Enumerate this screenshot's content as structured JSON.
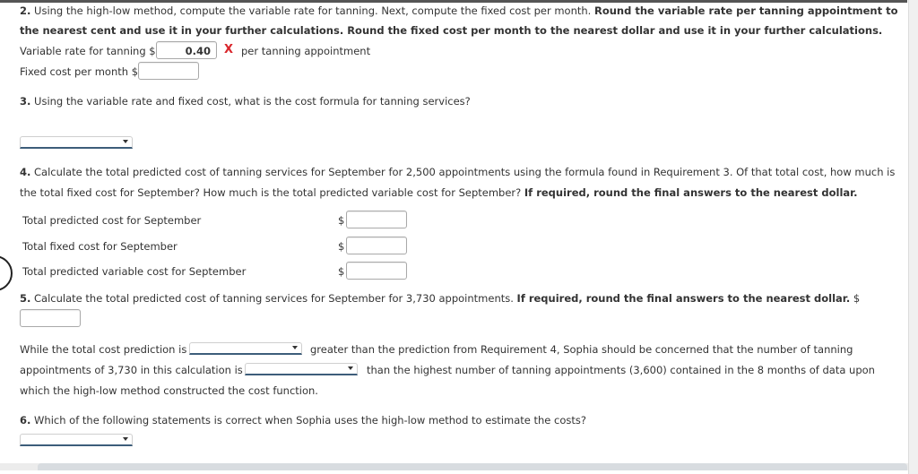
{
  "q2": {
    "number": "2.",
    "text_line1_normal": "Using the high-low method, compute the variable rate for tanning. Next, compute the fixed cost per month.",
    "text_line1_bold": "Round the variable rate per tanning appointment to",
    "text_line2_bold": "the nearest cent and use it in your further calculations. Round the fixed cost per month to the nearest dollar and use it in your further calculations.",
    "variable_rate_label": "Variable rate for tanning $",
    "variable_rate_value": "0.40",
    "variable_rate_status_icon": "x-mark-incorrect",
    "variable_rate_status_glyph": "X",
    "variable_rate_unit": "per tanning appointment",
    "fixed_cost_label": "Fixed cost per month $",
    "fixed_cost_value": ""
  },
  "q3": {
    "number": "3.",
    "text": "Using the variable rate and fixed cost, what is the cost formula for tanning services?",
    "select_value": ""
  },
  "q4": {
    "number": "4.",
    "text_line1": "Calculate the total predicted cost of tanning services for September for 2,500 appointments using the formula found in Requirement 3. Of that total cost, how much is",
    "text_line2_normal": "the total fixed cost for September? How much is the total predicted variable cost for September?",
    "text_line2_bold": "If required, round the final answers to the nearest dollar.",
    "rows": [
      {
        "label": "Total predicted cost for September",
        "currency": "$",
        "value": ""
      },
      {
        "label": "Total fixed cost for September",
        "currency": "$",
        "value": ""
      },
      {
        "label": "Total predicted variable cost for September",
        "currency": "$",
        "value": ""
      }
    ]
  },
  "q5": {
    "number": "5.",
    "text_normal": "Calculate the total predicted cost of tanning services for September for 3,730 appointments.",
    "text_bold": "If required, round the final answers to the nearest dollar.",
    "currency": "$",
    "answer_value": "",
    "para_part1": "While the total cost prediction is",
    "select1_value": "",
    "para_part2": "greater than the prediction from Requirement 4, Sophia should be concerned that the number of tanning",
    "para_part3": "appointments of 3,730 in this calculation is",
    "select2_value": "",
    "para_part4": "than the highest number of tanning appointments (3,600) contained in the 8 months of data upon",
    "para_part5": "which the high-low method constructed the cost function."
  },
  "q6": {
    "number": "6.",
    "text": "Which of the following statements is correct when Sophia uses the high-low method to estimate the costs?",
    "select_value": ""
  },
  "colors": {
    "incorrect_mark": "#d9262c",
    "select_underline": "#3d5d7a",
    "text": "#333333"
  }
}
